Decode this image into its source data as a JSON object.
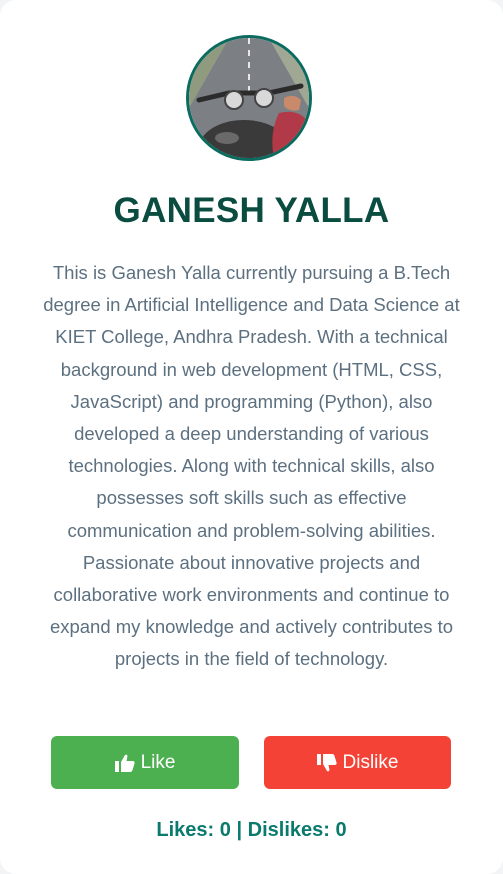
{
  "profile": {
    "name": "GANESH YALLA",
    "avatar_alt": "Motorcycle handlebars on road",
    "bio": "This is Ganesh Yalla currently pursuing a B.Tech degree in Artificial Intelligence and Data Science at KIET College, Andhra Pradesh. With a technical background in web development (HTML, CSS, JavaScript) and programming (Python), also developed a deep understanding of various technologies. Along with technical skills, also possesses soft skills such as effective communication and problem-solving abilities. Passionate about innovative projects and collaborative work environments and continue to expand my knowledge and actively contributes to projects in the field of technology."
  },
  "actions": {
    "like_label": "Like",
    "like_icon": "thumbs-up-icon",
    "dislike_label": "Dislike",
    "dislike_icon": "thumbs-down-icon"
  },
  "counts": {
    "likes_label": "Likes:",
    "likes": "0",
    "separator": "|",
    "dislikes_label": "Dislikes:",
    "dislikes": "0"
  },
  "colors": {
    "accent": "#0a4c3f",
    "like": "#4caf50",
    "dislike": "#f44336",
    "counts": "#0b7a6e"
  }
}
